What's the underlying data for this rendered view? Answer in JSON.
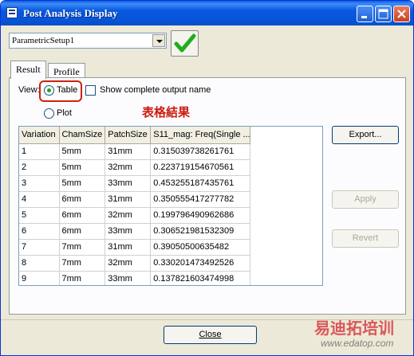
{
  "window": {
    "title": "Post Analysis Display"
  },
  "setup": {
    "selected": "ParametricSetup1"
  },
  "tabs": [
    {
      "label": "Result"
    },
    {
      "label": "Profile"
    }
  ],
  "view": {
    "label": "View:",
    "table_label": "Table",
    "plot_label": "Plot",
    "show_complete_label": "Show complete output name",
    "selected": "Table"
  },
  "annotation": {
    "text": "表格結果",
    "color": "#cc1a10"
  },
  "table": {
    "columns": [
      "Variation",
      "ChamSize",
      "PatchSize",
      "S11_mag: Freq(Single ..."
    ],
    "rows": [
      [
        "1",
        "5mm",
        "31mm",
        "0.315039738261761"
      ],
      [
        "2",
        "5mm",
        "32mm",
        "0.223719154670561"
      ],
      [
        "3",
        "5mm",
        "33mm",
        "0.453255187435761"
      ],
      [
        "4",
        "6mm",
        "31mm",
        "0.350555417277782"
      ],
      [
        "5",
        "6mm",
        "32mm",
        "0.199796490962686"
      ],
      [
        "6",
        "6mm",
        "33mm",
        "0.306521981532309"
      ],
      [
        "7",
        "7mm",
        "31mm",
        "0.39050500635482"
      ],
      [
        "8",
        "7mm",
        "32mm",
        "0.330201473492526"
      ],
      [
        "9",
        "7mm",
        "33mm",
        "0.137821603474998"
      ]
    ]
  },
  "buttons": {
    "export": "Export...",
    "apply": "Apply",
    "revert": "Revert",
    "close": "Close"
  },
  "watermark": {
    "title": "易迪拓培训",
    "url": "www.edatop.com"
  },
  "colors": {
    "titlebar": "#0654d8",
    "check": "#1fae1f",
    "annotation": "#cc1a10"
  }
}
